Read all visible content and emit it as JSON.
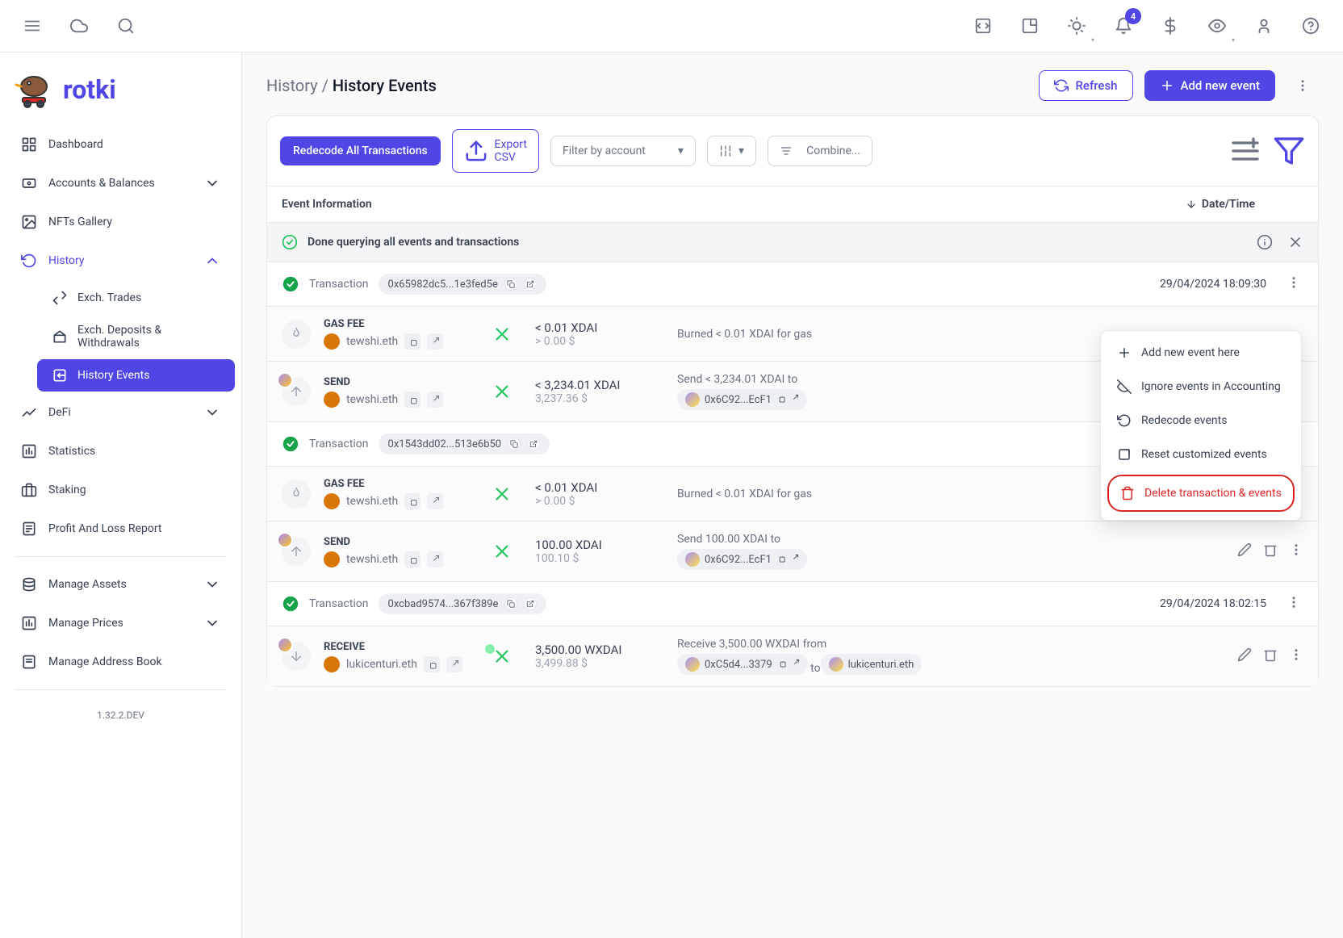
{
  "topbar": {
    "notification_count": "4"
  },
  "brand": {
    "name": "rotki"
  },
  "sidebar": {
    "items": [
      {
        "label": "Dashboard"
      },
      {
        "label": "Accounts & Balances"
      },
      {
        "label": "NFTs Gallery"
      },
      {
        "label": "History"
      },
      {
        "label": "DeFi"
      },
      {
        "label": "Statistics"
      },
      {
        "label": "Staking"
      },
      {
        "label": "Profit And Loss Report"
      }
    ],
    "history_sub": [
      {
        "label": "Exch. Trades"
      },
      {
        "label": "Exch. Deposits & Withdrawals"
      },
      {
        "label": "History Events"
      }
    ],
    "manage": [
      {
        "label": "Manage Assets"
      },
      {
        "label": "Manage Prices"
      },
      {
        "label": "Manage Address Book"
      }
    ]
  },
  "version": "1.32.2.DEV",
  "breadcrumb": {
    "parent": "History",
    "current": "History Events"
  },
  "actions": {
    "refresh": "Refresh",
    "add": "Add new event"
  },
  "toolbar": {
    "redecode": "Redecode All Transactions",
    "export": "Export CSV",
    "filter_account": "Filter by account",
    "combine": "Combine..."
  },
  "table": {
    "col_info": "Event Information",
    "col_date": "Date/Time",
    "status": "Done querying all events and transactions"
  },
  "dropdown": {
    "add": "Add new event here",
    "ignore": "Ignore events in Accounting",
    "redecode": "Redecode events",
    "reset": "Reset customized events",
    "delete": "Delete transaction & events"
  },
  "txs": [
    {
      "hash": "0x65982dc5...1e3fed5e",
      "date": "29/04/2024 18:09:30",
      "events": [
        {
          "type": "GAS FEE",
          "who": "tewshi.eth",
          "amount": "< 0.01 XDAI",
          "fiat": "> 0.00 $",
          "desc": "Burned < 0.01 XDAI for gas",
          "direction": "flame"
        },
        {
          "type": "SEND",
          "who": "tewshi.eth",
          "amount": "< 3,234.01 XDAI",
          "fiat": "3,237.36 $",
          "desc": "Send < 3,234.01 XDAI to",
          "addr": "0x6C92...EcF1",
          "direction": "up"
        }
      ]
    },
    {
      "hash": "0x1543dd02...513e6b50",
      "date": "",
      "events": [
        {
          "type": "GAS FEE",
          "who": "tewshi.eth",
          "amount": "< 0.01 XDAI",
          "fiat": "> 0.00 $",
          "desc": "Burned < 0.01 XDAI for gas",
          "direction": "flame"
        },
        {
          "type": "SEND",
          "who": "tewshi.eth",
          "amount": "100.00 XDAI",
          "fiat": "100.10 $",
          "desc": "Send 100.00 XDAI to",
          "addr": "0x6C92...EcF1",
          "direction": "up"
        }
      ]
    },
    {
      "hash": "0xcbad9574...367f389e",
      "date": "29/04/2024 18:02:15",
      "events": [
        {
          "type": "RECEIVE",
          "who": "lukicenturi.eth",
          "amount": "3,500.00 WXDAI",
          "fiat": "3,499.88 $",
          "desc": "Receive 3,500.00 WXDAI from",
          "addr": "0xC5d4...3379",
          "suffix": "to",
          "addr2": "lukicenturi.eth",
          "direction": "down"
        }
      ]
    }
  ]
}
